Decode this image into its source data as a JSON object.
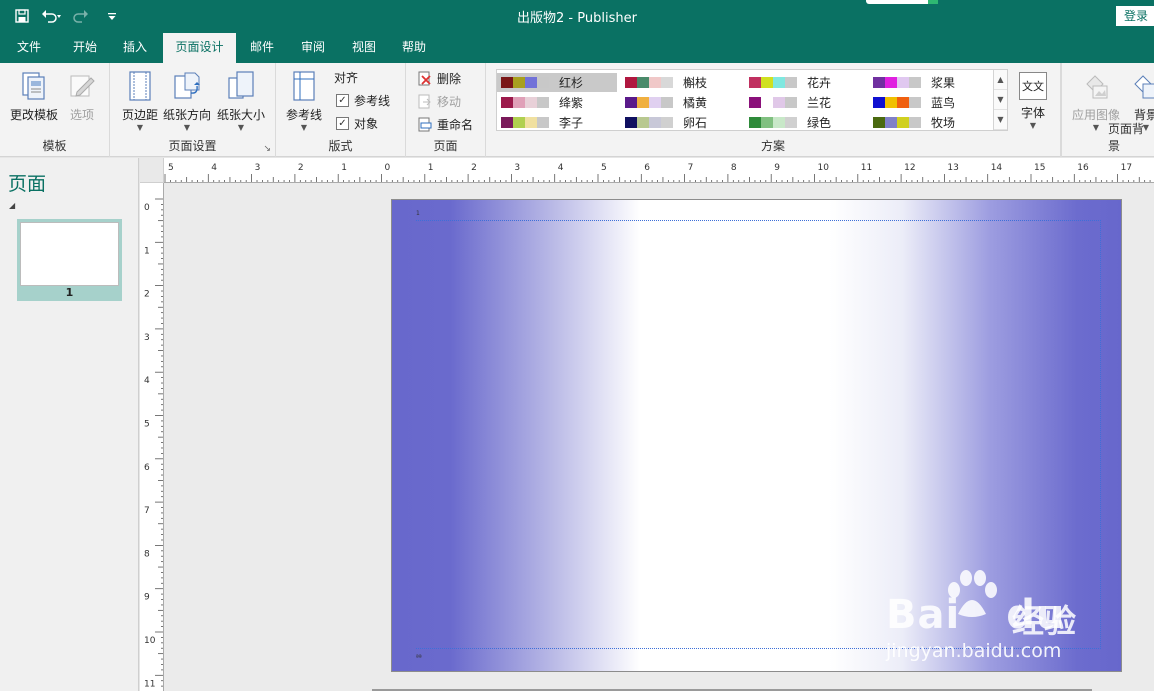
{
  "window": {
    "title": "出版物2  -  Publisher",
    "sign_in": "登录"
  },
  "quick_access": {
    "icons": [
      "save-icon",
      "undo-icon",
      "redo-icon",
      "customize-icon"
    ]
  },
  "tabs": [
    {
      "label": "文件",
      "active": false
    },
    {
      "label": "开始",
      "active": false
    },
    {
      "label": "插入",
      "active": false
    },
    {
      "label": "页面设计",
      "active": true
    },
    {
      "label": "邮件",
      "active": false
    },
    {
      "label": "审阅",
      "active": false
    },
    {
      "label": "视图",
      "active": false
    },
    {
      "label": "帮助",
      "active": false
    }
  ],
  "ribbon": {
    "template": {
      "label": "模板",
      "change_template": "更改模板",
      "options": "选项"
    },
    "page_setup": {
      "label": "页面设置",
      "margins": "页边距",
      "orientation": "纸张方向",
      "size": "纸张大小"
    },
    "layout": {
      "label": "版式",
      "guides": "参考线",
      "align_title": "对齐",
      "align_guides": "参考线",
      "align_objects": "对象"
    },
    "pages": {
      "label": "页面",
      "delete": "删除",
      "move": "移动",
      "rename": "重命名"
    },
    "schemes": {
      "label": "方案",
      "items": [
        {
          "name": "红杉",
          "colors": [
            "#7a1616",
            "#a8a01e",
            "#7272d8",
            "#c8c8c8"
          ],
          "selected": true
        },
        {
          "name": "绛紫",
          "colors": [
            "#9c1a4b",
            "#e0a0b8",
            "#e8d0d8",
            "#c8c8c8"
          ],
          "selected": false
        },
        {
          "name": "李子",
          "colors": [
            "#7a1a5a",
            "#b0d050",
            "#f0e0a0",
            "#c8c8c8"
          ],
          "selected": false
        },
        {
          "name": "槲枝",
          "colors": [
            "#b01840",
            "#4a8a6a",
            "#f0c8c8",
            "#d8d8d8"
          ],
          "selected": false
        },
        {
          "name": "橘黄",
          "colors": [
            "#5a1a8a",
            "#f0b040",
            "#e0d0f0",
            "#c8c8c8"
          ],
          "selected": false
        },
        {
          "name": "卵石",
          "colors": [
            "#101060",
            "#b8c890",
            "#c8c8d8",
            "#d0d0d0"
          ],
          "selected": false
        },
        {
          "name": "花卉",
          "colors": [
            "#c03060",
            "#d0e020",
            "#80e8e0",
            "#c8c8c8"
          ],
          "selected": false
        },
        {
          "name": "兰花",
          "colors": [
            "#8a107a",
            "#ffffff",
            "#e0c8e8",
            "#c8c8c8"
          ],
          "selected": false
        },
        {
          "name": "绿色",
          "colors": [
            "#2e8a3a",
            "#80c080",
            "#c8e8c8",
            "#d0d0d0"
          ],
          "selected": false
        },
        {
          "name": "浆果",
          "colors": [
            "#7030a0",
            "#e020e0",
            "#e0c8f0",
            "#c8c8c8"
          ],
          "selected": false
        },
        {
          "name": "蓝鸟",
          "colors": [
            "#1010d0",
            "#f0c000",
            "#f06010",
            "#c8c8c8"
          ],
          "selected": false
        },
        {
          "name": "牧场",
          "colors": [
            "#4a6a10",
            "#8080c8",
            "#d0d020",
            "#c8c8c8"
          ],
          "selected": false
        }
      ]
    },
    "fonts": {
      "label": "字体",
      "icon_text": "文文"
    },
    "page_background": {
      "label": "页面背景",
      "apply_image": "应用图像",
      "background": "背景"
    }
  },
  "pages_pane": {
    "title": "页面",
    "pages": [
      {
        "number": "1"
      }
    ]
  },
  "rulers": {
    "horizontal": [
      "5",
      "4",
      "3",
      "2",
      "1",
      "0",
      "1",
      "2",
      "3",
      "4",
      "5",
      "6",
      "7",
      "8",
      "9",
      "10",
      "11",
      "12",
      "13",
      "14",
      "15",
      "16",
      "17"
    ],
    "vertical": [
      "0",
      "1",
      "2",
      "3",
      "4",
      "5",
      "6",
      "7",
      "8",
      "9",
      "10",
      "11"
    ]
  },
  "canvas": {
    "page_mark_top": "1",
    "page_mark_bottom": "ªª"
  },
  "watermark": {
    "brand": "Bai",
    "brand2": "du",
    "cn": "经验",
    "url": "jingyan.baidu.com"
  },
  "colors": {
    "accent": "#0a7163",
    "page_edge": "#6767cc",
    "guide": "#3d6fd8"
  }
}
